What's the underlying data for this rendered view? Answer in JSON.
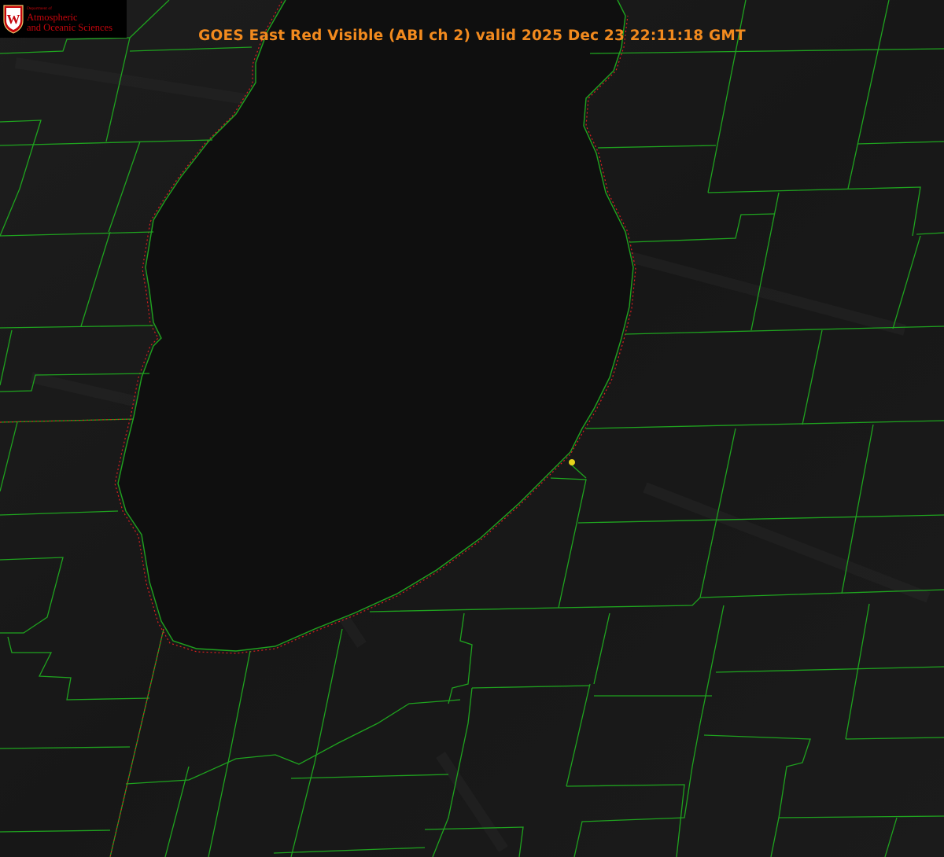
{
  "title": "GOES East Red Visible (ABI ch 2) valid 2025 Dec 23 22:11:18 GMT",
  "logo": {
    "crest_letter": "W",
    "dept_line": "Department of",
    "line1": "Atmospheric",
    "line2": "and Oceanic Sciences"
  },
  "colors": {
    "background": "#161616",
    "lake": "#0e0e0e",
    "boundaries": "#1fa31f",
    "coastline_dotted": "#d91f1f",
    "title": "#f28a1e",
    "marker": "#e6d21c",
    "logo_red": "#c5050c"
  },
  "features": {
    "lake": "lake-michigan",
    "marker": "location-marker"
  }
}
